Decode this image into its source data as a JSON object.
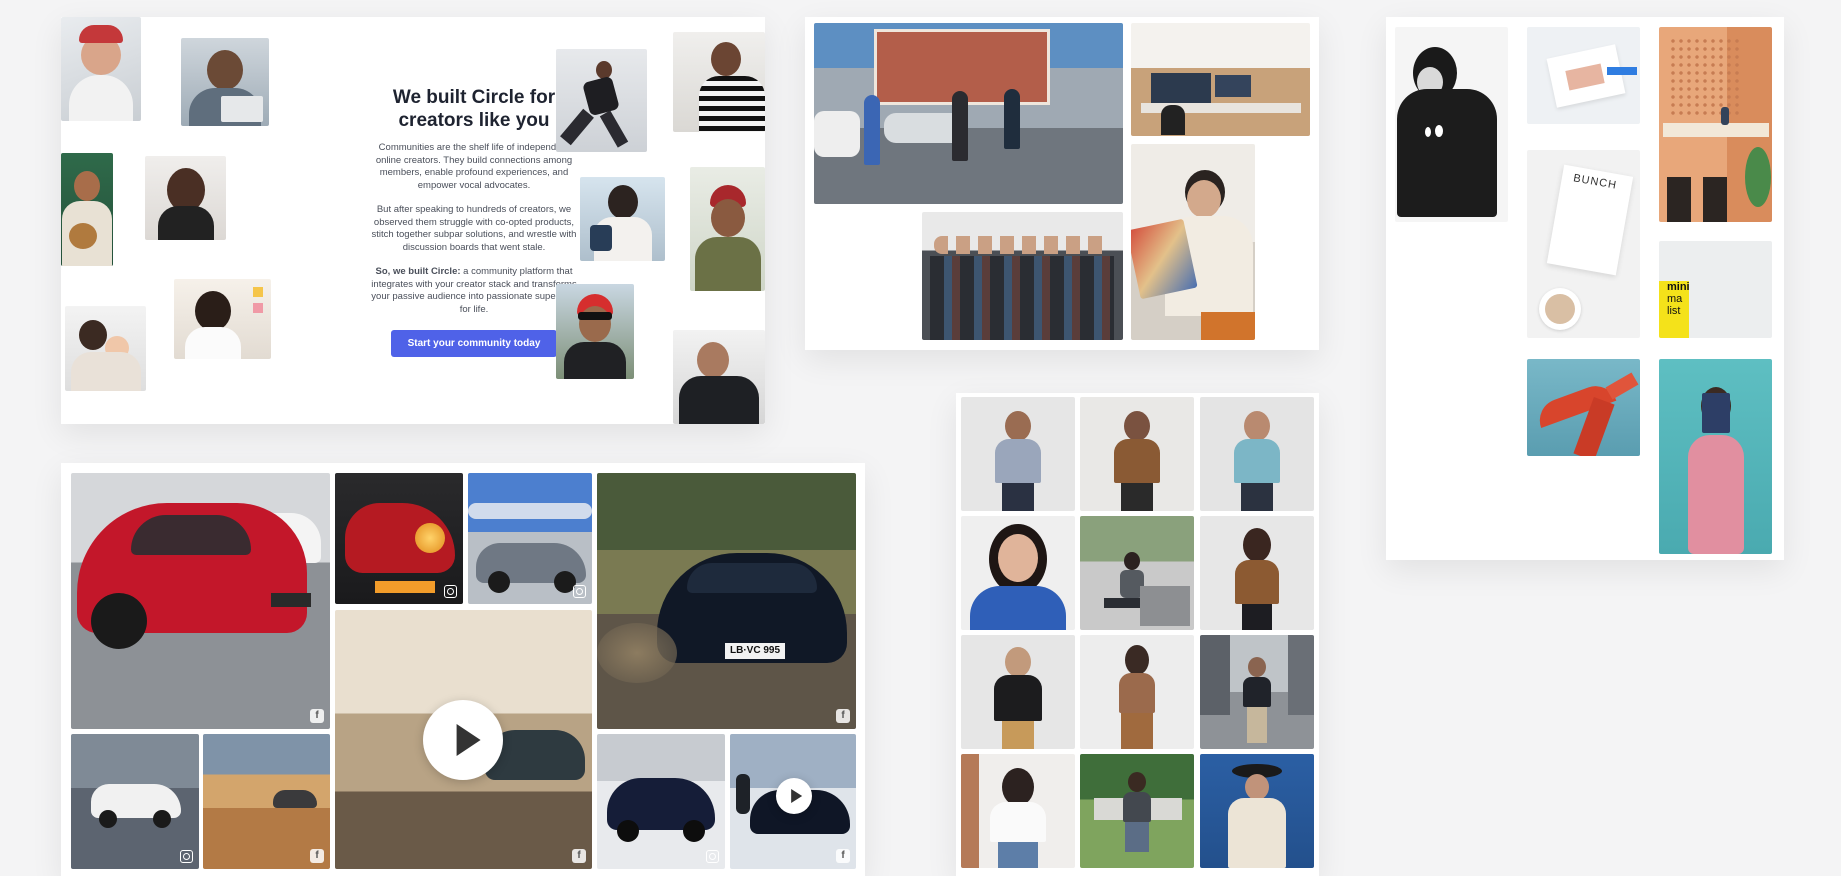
{
  "circle": {
    "heading": "We built Circle for creators like you",
    "para1": "Communities are the shelf life of independent online creators. They build connections among members, enable profound experiences, and empower vocal advocates.",
    "para2": "But after speaking to hundreds of creators, we observed them struggle with co-opted products, stitch together subpar solutions, and wrestle with discussion boards that went stale.",
    "para3_bold": "So, we built Circle:",
    "para3_rest": " a community platform that integrates with your creator stack and transforms your passive audience into passionate superfans for life.",
    "cta_label": "Start your community today"
  },
  "product_card": {
    "booklet_title": "BUNCH",
    "magazine_text_1": "mini",
    "magazine_text_2": "ma",
    "magazine_text_3": "list"
  },
  "cars": {
    "plate_text": "LB·VC 995"
  },
  "colors": {
    "accent": "#4f62e8",
    "page_bg": "#f4f4f5",
    "card_bg": "#ffffff"
  }
}
